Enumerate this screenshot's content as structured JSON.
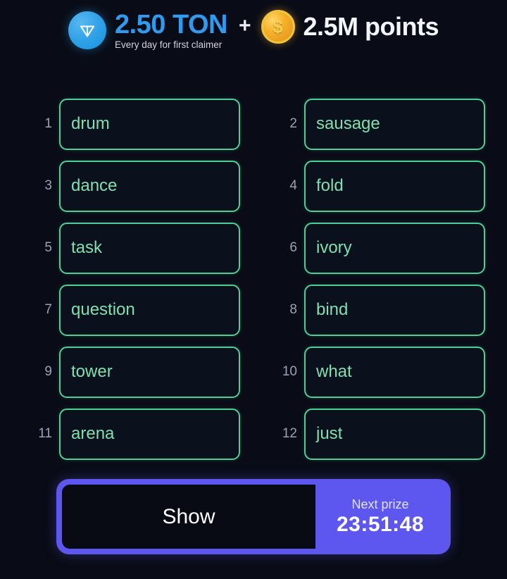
{
  "theme": {
    "background": "#090c16",
    "word_border": "#4fcf96",
    "word_text": "#7fe0b0",
    "ton_blue": "#2f9aee",
    "accent_purple": "#5e57ef",
    "number_gray": "#9aa2b5",
    "coin_gold": "#f0c43c"
  },
  "header": {
    "ton_icon": "ton-diamond-icon",
    "ton_amount": "2.50 TON",
    "ton_subtitle": "Every day for first claimer",
    "plus": "+",
    "coin_icon": "dollar-coin-icon",
    "coin_glyph": "$",
    "points_amount": "2.5M points"
  },
  "words": [
    {
      "number": "1",
      "word": "drum"
    },
    {
      "number": "2",
      "word": "sausage"
    },
    {
      "number": "3",
      "word": "dance"
    },
    {
      "number": "4",
      "word": "fold"
    },
    {
      "number": "5",
      "word": "task"
    },
    {
      "number": "6",
      "word": "ivory"
    },
    {
      "number": "7",
      "word": "question"
    },
    {
      "number": "8",
      "word": "bind"
    },
    {
      "number": "9",
      "word": "tower"
    },
    {
      "number": "10",
      "word": "what"
    },
    {
      "number": "11",
      "word": "arena"
    },
    {
      "number": "12",
      "word": "just"
    }
  ],
  "action_bar": {
    "show_label": "Show",
    "prize_label": "Next prize",
    "prize_timer": "23:51:48"
  }
}
